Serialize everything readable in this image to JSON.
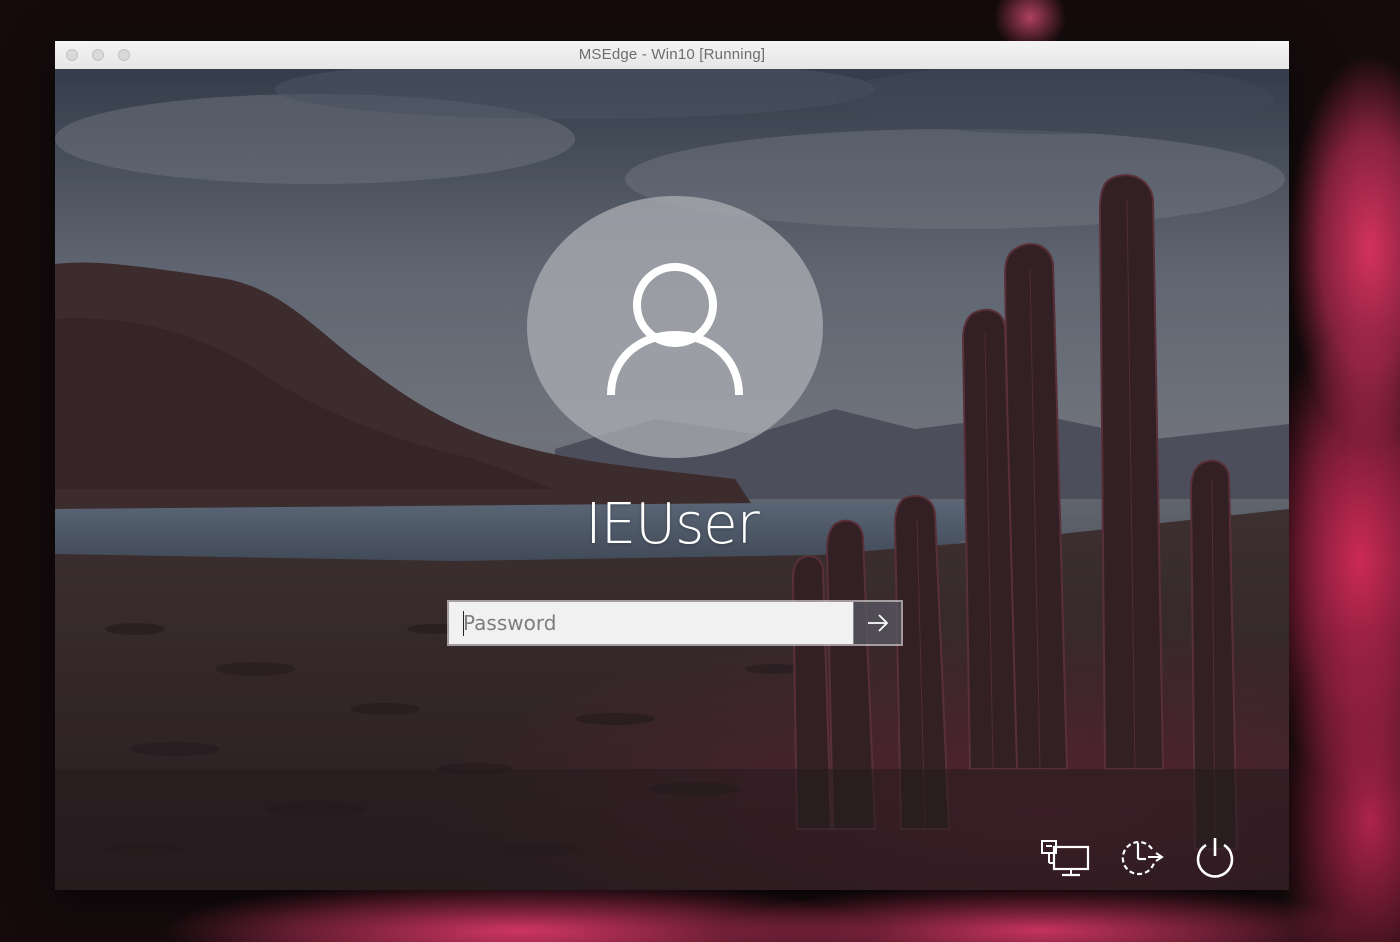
{
  "window": {
    "title": "MSEdge - Win10 [Running]"
  },
  "lock_screen": {
    "username": "IEUser",
    "avatar_icon": "user-icon",
    "password": {
      "placeholder": "Password",
      "value": "",
      "submit_icon": "arrow-right-icon"
    },
    "corner_buttons": [
      {
        "name": "network",
        "icon": "network-icon"
      },
      {
        "name": "ease-of-access",
        "icon": "ease-of-access-icon"
      },
      {
        "name": "power",
        "icon": "power-icon"
      }
    ]
  },
  "colors": {
    "desktop_background": "#150b0d",
    "desktop_accent": "#de3462",
    "titlebar": "#ececec",
    "input_background": "#f1f1f1",
    "text_on_scene": "#ffffff"
  }
}
